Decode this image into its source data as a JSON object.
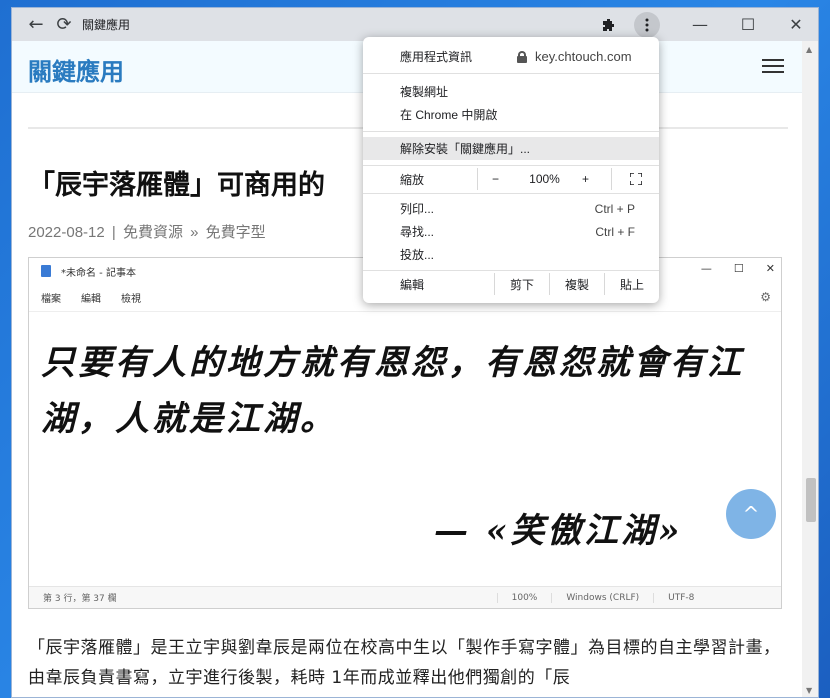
{
  "browser": {
    "tab_title": "關鍵應用",
    "back_icon": "←",
    "reload_icon": "⟳",
    "minimize": "—",
    "maximize": "☐",
    "close": "✕"
  },
  "site": {
    "title": "關鍵應用"
  },
  "article": {
    "title": "「辰宇落雁體」可商用的",
    "date": "2022-08-12",
    "category": "免費資源",
    "subcategory": "免費字型",
    "paragraph": "「辰宇落雁體」是王立宇與劉韋辰是兩位在校高中生以「製作手寫字體」為目標的自主學習計畫，由韋辰負責書寫，立宇進行後製，耗時 1年而成並釋出他們獨創的「辰"
  },
  "notepad": {
    "title": "*未命名 - 記事本",
    "menu": [
      "檔案",
      "編輯",
      "檢視"
    ],
    "line1": "只要有人的地方就有恩怨，有恩怨就會有江",
    "line2": "湖，人就是江湖。",
    "signature": "— «笑傲江湖»",
    "status": [
      "第 3 行，第 37 欄",
      "100%",
      "Windows (CRLF)",
      "UTF-8"
    ]
  },
  "menu": {
    "app_info": "應用程式資訊",
    "domain": "key.chtouch.com",
    "copy_url": "複製網址",
    "open_in_chrome": "在 Chrome 中開啟",
    "uninstall": "解除安裝「關鍵應用」...",
    "zoom_label": "縮放",
    "zoom_minus": "−",
    "zoom_value": "100%",
    "zoom_plus": "+",
    "print": "列印...",
    "print_shortcut": "Ctrl + P",
    "find": "尋找...",
    "find_shortcut": "Ctrl + F",
    "cast": "投放...",
    "edit_label": "編輯",
    "cut": "剪下",
    "copy": "複製",
    "paste": "貼上"
  },
  "scroll_top_icon": "^",
  "colors": {
    "accent": "#2a7bc0",
    "scroll_top": "#7fb4e6",
    "desktop": "#1f6fd1"
  }
}
